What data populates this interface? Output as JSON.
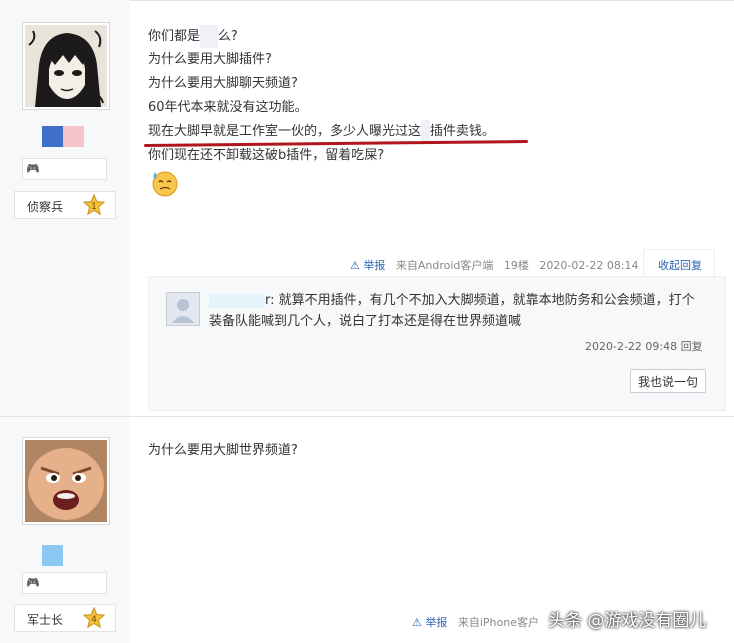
{
  "post1": {
    "rank": "侦察兵",
    "rank_level": "1",
    "lines": [
      "你们都是",
      "么?",
      "为什么要用大脚插件?",
      "为什么要用大脚聊天频道?",
      "60年代本来就没有这功能。",
      "现在大脚早就是工作室一伙的，多少人曝光过这",
      "插件卖钱。",
      "你们现在还不卸载这破b插件，留着吃屎?"
    ],
    "meta": {
      "report": "举报",
      "source": "来自Android客户端",
      "floor": "19楼",
      "time": "2020-02-22 08:14",
      "collapse": "收起回复"
    },
    "reply": {
      "name_tail": "r:",
      "text": "就算不用插件，有几个不加入大脚频道，就靠本地防务和公会频道，打个装备队能喊到几个人，说白了打本还是得在世界频道喊",
      "time": "2020-2-22 09:48",
      "reply_link": "回复",
      "button": "我也说一句"
    }
  },
  "post2": {
    "rank": "军士长",
    "rank_level": "4",
    "text": "为什么要用大脚世界频道?",
    "meta": {
      "report": "举报",
      "source": "来自iPhone客户"
    }
  },
  "watermark": "头条 @游戏没有圈儿"
}
